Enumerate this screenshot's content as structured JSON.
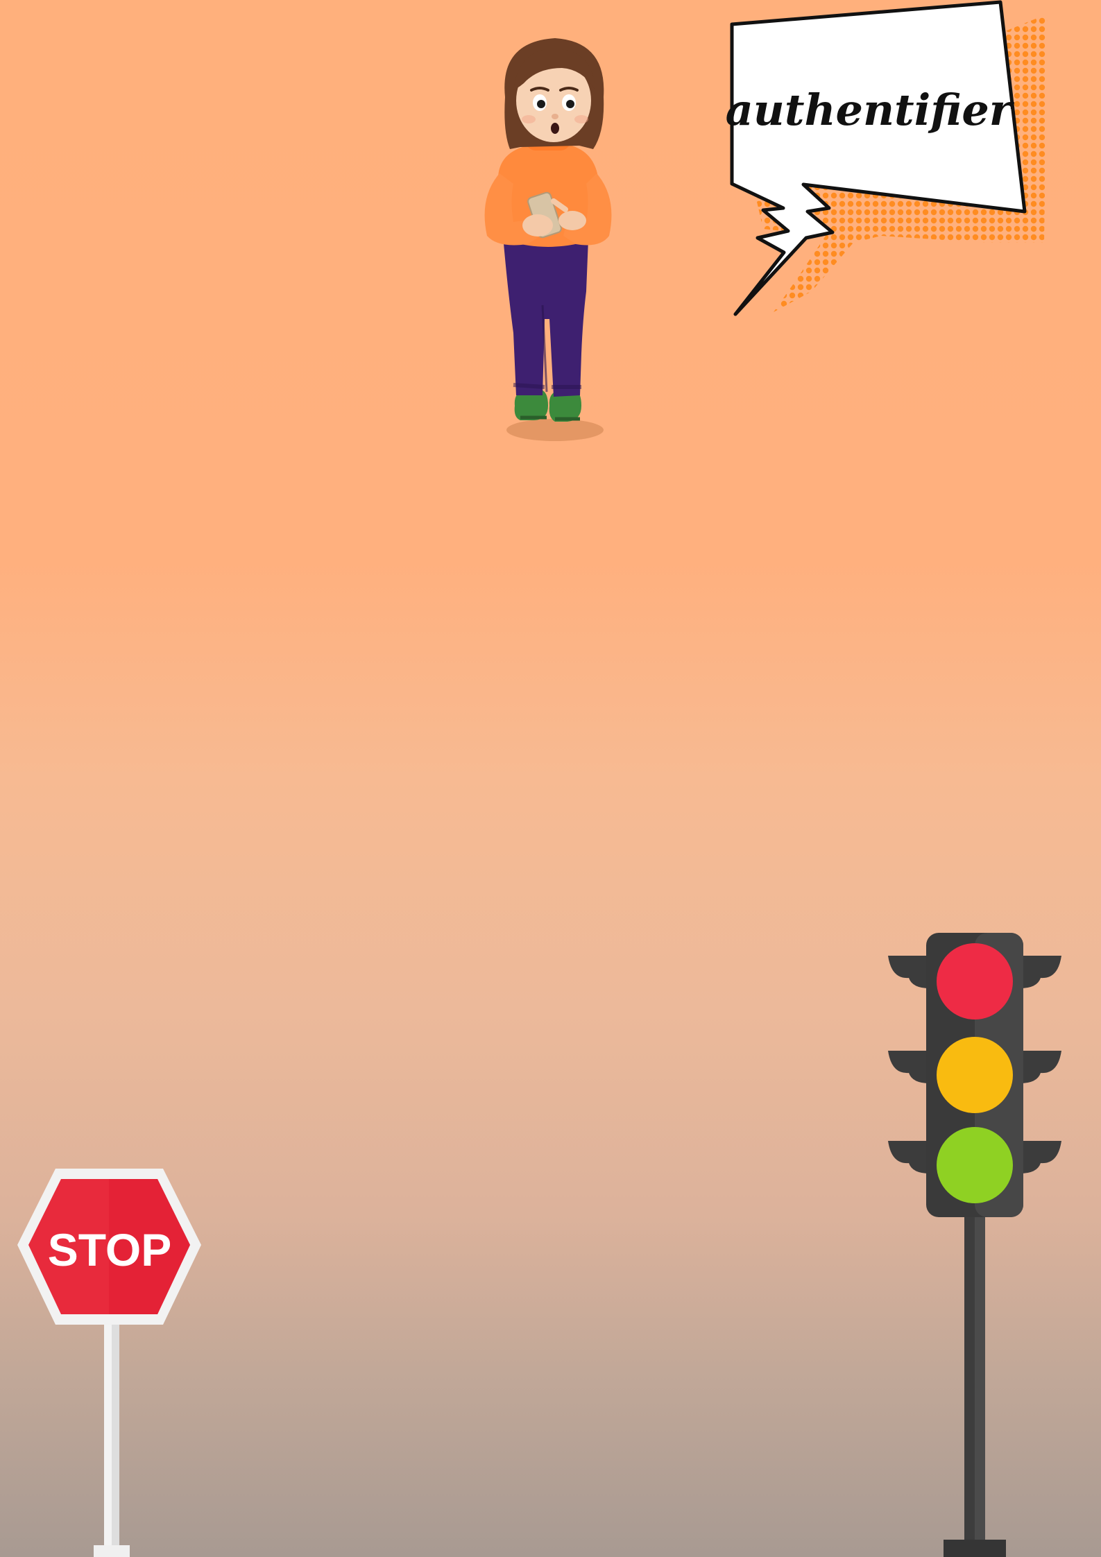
{
  "speech_bubble": {
    "text": "authentifier"
  },
  "stop_sign": {
    "text": "STOP",
    "color": "#e82a3c"
  },
  "traffic_light": {
    "lights": [
      {
        "name": "red",
        "color": "#ee2b45"
      },
      {
        "name": "yellow",
        "color": "#f9bb10"
      },
      {
        "name": "green",
        "color": "#8fd123"
      }
    ]
  },
  "colors": {
    "background_top": "#ffb07c",
    "background_bottom": "#a89a92",
    "bubble_dots": "#ff8a1c"
  }
}
